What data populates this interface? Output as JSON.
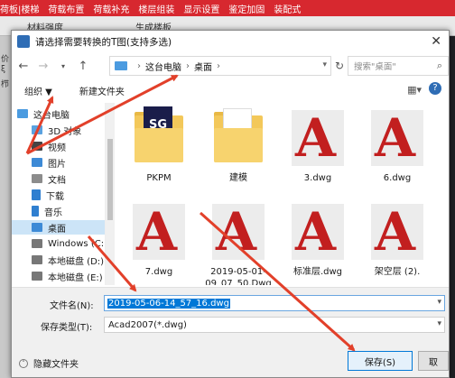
{
  "app": {
    "menu": [
      "荷板|楼梯",
      "荷载布置",
      "荷载补充",
      "楼层组装",
      "显示设置",
      "鉴定加固",
      "装配式"
    ],
    "toolbar": [
      "材料强度",
      "生成楼板"
    ],
    "left_labels": [
      "价",
      "ξ",
      "栉"
    ]
  },
  "dialog": {
    "title": "请选择需要转换的T图(支持多选)",
    "close_glyph": "✕",
    "address": {
      "crumbs": [
        "这台电脑",
        "桌面"
      ]
    },
    "search_placeholder": "搜索\"桌面\"",
    "organize_label": "组织 ▼",
    "new_folder_label": "新建文件夹",
    "nav_items": [
      {
        "label": "这台电脑",
        "icon": "computer-icon",
        "color": "#4b9be0"
      },
      {
        "label": "3D 对象",
        "icon": "cube-icon",
        "color": "#5aa2e0"
      },
      {
        "label": "视频",
        "icon": "video-icon",
        "color": "#444444"
      },
      {
        "label": "图片",
        "icon": "picture-icon",
        "color": "#3d8ad6"
      },
      {
        "label": "文档",
        "icon": "document-icon",
        "color": "#8c8c8c"
      },
      {
        "label": "下载",
        "icon": "download-icon",
        "color": "#2f7fd0"
      },
      {
        "label": "音乐",
        "icon": "music-icon",
        "color": "#2f7fd0"
      },
      {
        "label": "桌面",
        "icon": "desktop-icon",
        "color": "#3d8ad6",
        "selected": true
      },
      {
        "label": "Windows (C:)",
        "icon": "drive-c-icon",
        "color": "#777777"
      },
      {
        "label": "本地磁盘 (D:)",
        "icon": "drive-d-icon",
        "color": "#777777"
      },
      {
        "label": "本地磁盘 (E:)",
        "icon": "drive-e-icon",
        "color": "#777777"
      }
    ],
    "files": [
      {
        "name": "PKPM",
        "kind": "pkpm-folder"
      },
      {
        "name": "建模",
        "kind": "folder"
      },
      {
        "name": "3.dwg",
        "kind": "dwg"
      },
      {
        "name": "6.dwg",
        "kind": "dwg"
      },
      {
        "name": "7.dwg",
        "kind": "dwg"
      },
      {
        "name": "2019-05-01-09_07_50.Dwg",
        "kind": "dwg"
      },
      {
        "name": "标准层.dwg",
        "kind": "dwg"
      },
      {
        "name": "架空层 (2).",
        "kind": "dwg"
      }
    ],
    "filename_label": "文件名(N):",
    "filename_value": "2019-05-06-14_57_16.dwg",
    "filetype_label": "保存类型(T):",
    "filetype_value": "Acad2007(*.dwg)",
    "hide_folders_label": "隐藏文件夹",
    "save_label": "保存(S)",
    "cancel_label": "取",
    "accent": "#0078d7",
    "annotation_color": "#e2402a"
  }
}
